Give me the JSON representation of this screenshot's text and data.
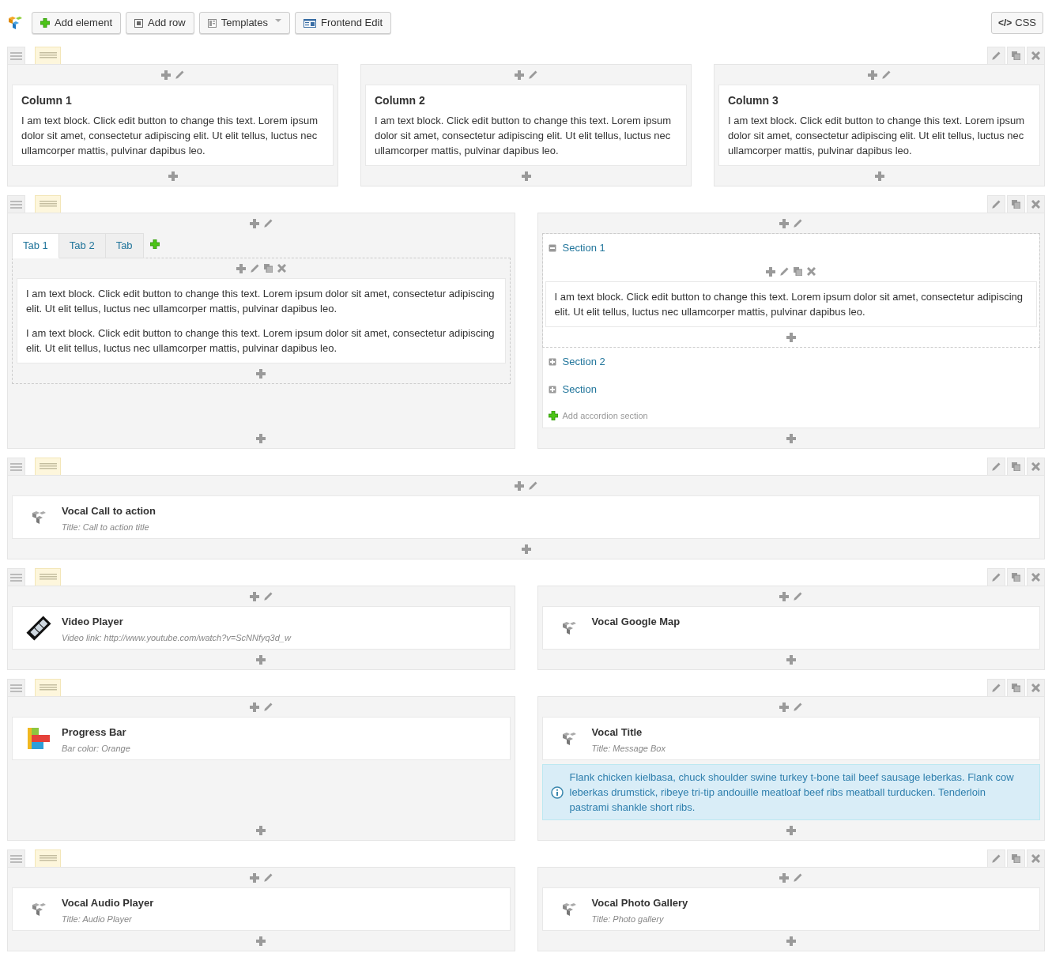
{
  "toolbar": {
    "buttons": [
      {
        "label": "Add element",
        "dropdown": false
      },
      {
        "label": "Add row",
        "dropdown": false
      },
      {
        "label": "Templates",
        "dropdown": true
      },
      {
        "label": "Frontend Edit",
        "dropdown": false
      }
    ],
    "css_button": {
      "glyph": "</>",
      "label": "CSS"
    }
  },
  "rows": [
    {
      "columns": [
        {
          "elements": [
            {
              "kind": "text",
              "title": "Column 1",
              "paragraphs": [
                "I am text block. Click edit button to change this text. Lorem ipsum dolor sit amet, consectetur adipiscing elit. Ut elit tellus, luctus nec ullamcorper mattis, pulvinar dapibus leo."
              ]
            }
          ]
        },
        {
          "elements": [
            {
              "kind": "text",
              "title": "Column 2",
              "paragraphs": [
                "I am text block. Click edit button to change this text. Lorem ipsum dolor sit amet, consectetur adipiscing elit. Ut elit tellus, luctus nec ullamcorper mattis, pulvinar dapibus leo."
              ]
            }
          ]
        },
        {
          "elements": [
            {
              "kind": "text",
              "title": "Column 3",
              "paragraphs": [
                "I am text block. Click edit button to change this text. Lorem ipsum dolor sit amet, consectetur adipiscing elit. Ut elit tellus, luctus nec ullamcorper mattis, pulvinar dapibus leo."
              ]
            }
          ]
        }
      ]
    },
    {
      "columns": [
        {
          "elements": [
            {
              "kind": "tabs",
              "tabs": [
                {
                  "label": "Tab 1",
                  "selected": true
                },
                {
                  "label": "Tab 2",
                  "selected": false
                },
                {
                  "label": "Tab",
                  "selected": false
                }
              ],
              "paragraphs": [
                "I am text block. Click edit button to change this text. Lorem ipsum dolor sit amet, consectetur adipiscing elit. Ut elit tellus, luctus nec ullamcorper mattis, pulvinar dapibus leo.",
                "I am text block. Click edit button to change this text. Lorem ipsum dolor sit amet, consectetur adipiscing elit. Ut elit tellus, luctus nec ullamcorper mattis, pulvinar dapibus leo."
              ]
            }
          ]
        },
        {
          "elements": [
            {
              "kind": "accordion",
              "sections": [
                {
                  "title": "Section 1",
                  "expanded": true,
                  "paragraphs": [
                    "I am text block. Click edit button to change this text. Lorem ipsum dolor sit amet, consectetur adipiscing elit. Ut elit tellus, luctus nec ullamcorper mattis, pulvinar dapibus leo."
                  ]
                },
                {
                  "title": "Section 2",
                  "expanded": false
                },
                {
                  "title": "Section",
                  "expanded": false
                }
              ],
              "add_label": "Add accordion section"
            }
          ]
        }
      ]
    },
    {
      "columns": [
        {
          "elements": [
            {
              "kind": "vocal",
              "title": "Vocal Call to action",
              "detail": "Title: Call to action title"
            }
          ]
        }
      ]
    },
    {
      "columns": [
        {
          "elements": [
            {
              "kind": "video",
              "title": "Video Player",
              "detail": "Video link: http://www.youtube.com/watch?v=ScNNfyq3d_w"
            }
          ]
        },
        {
          "elements": [
            {
              "kind": "vocal",
              "title": "Vocal Google Map"
            }
          ]
        }
      ]
    },
    {
      "columns": [
        {
          "elements": [
            {
              "kind": "progress",
              "title": "Progress Bar",
              "detail": "Bar color: Orange"
            }
          ]
        },
        {
          "elements": [
            {
              "kind": "vocal",
              "title": "Vocal Title",
              "detail": "Title: Message Box"
            },
            {
              "kind": "message",
              "text": "Flank chicken kielbasa, chuck shoulder swine turkey t-bone tail beef sausage leberkas. Flank cow leberkas drumstick, ribeye tri-tip andouille meatloaf beef ribs meatball turducken. Tenderloin pastrami shankle short ribs."
            }
          ]
        }
      ]
    },
    {
      "columns": [
        {
          "elements": [
            {
              "kind": "vocal",
              "title": "Vocal Audio Player",
              "detail": "Title: Audio Player"
            }
          ]
        },
        {
          "elements": [
            {
              "kind": "vocal",
              "title": "Vocal Photo Gallery",
              "detail": "Title: Photo gallery"
            }
          ]
        }
      ]
    }
  ]
}
